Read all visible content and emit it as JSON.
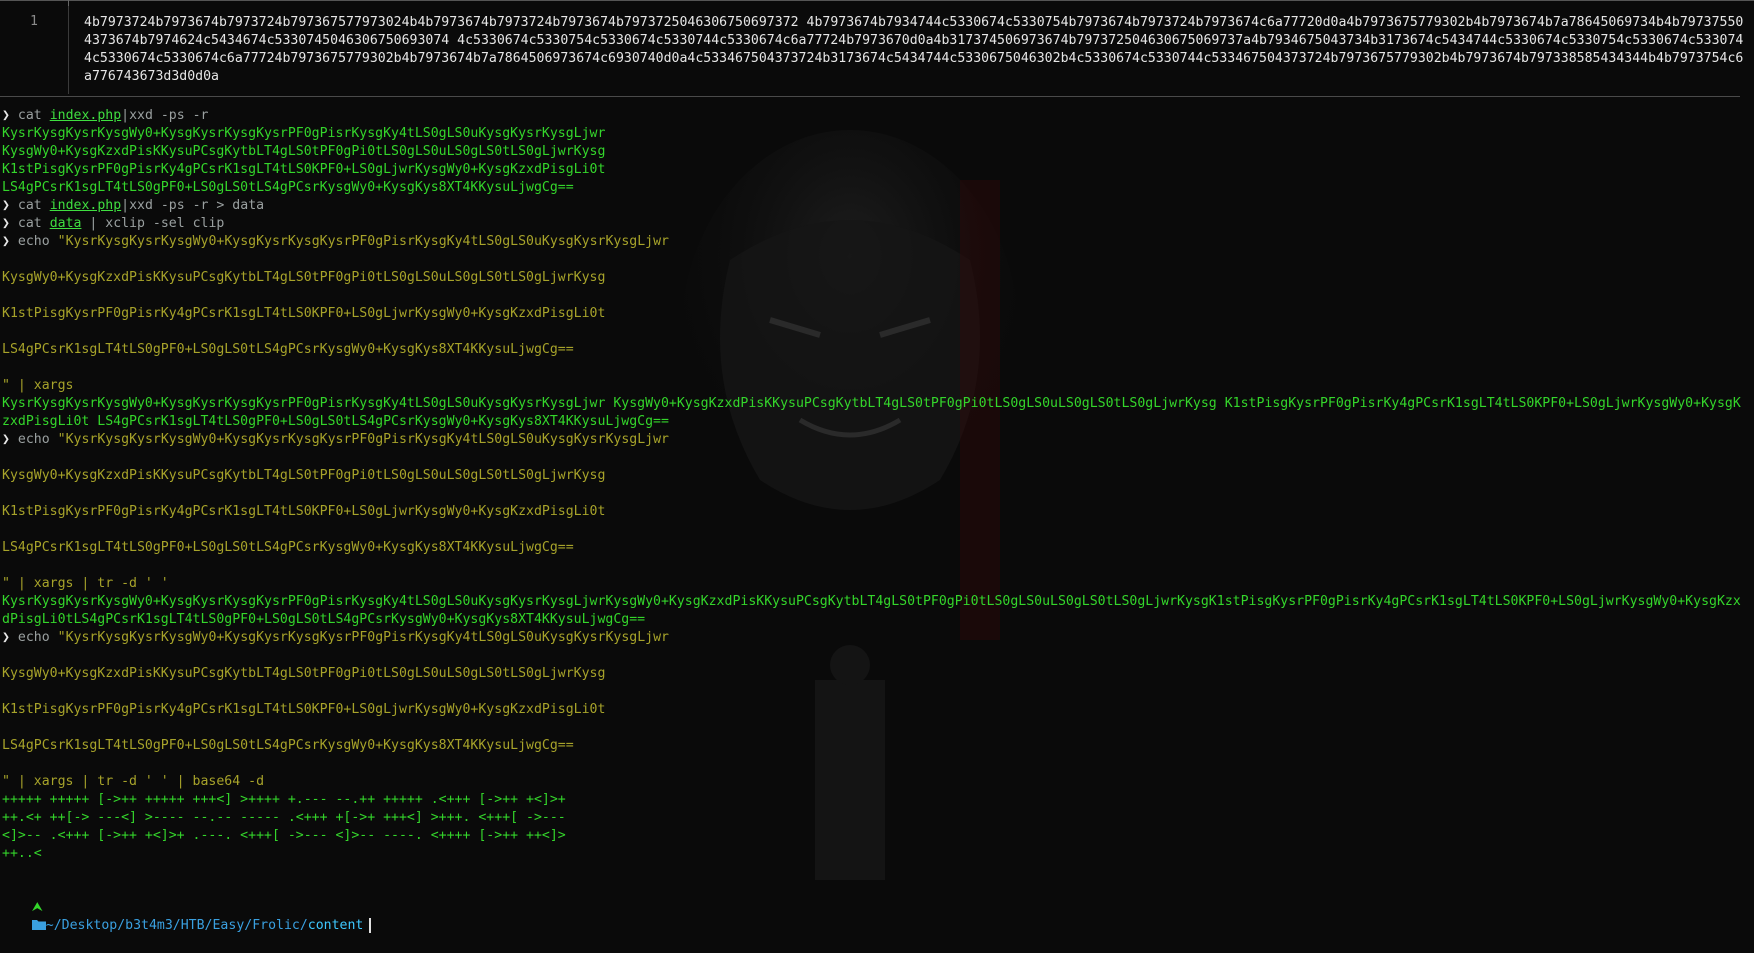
{
  "viewer": {
    "line_number": "1",
    "hex": "4b7973724b7973674b7973724b797367577973024b4b7973674b7973724b7973674b7973725046306750697372 4b7973674b7934744c5330674c5330754b7973674b7973724b7973674c6a77720d0a4b7973675779302b4b7973674b7a78645069734b4b797375504373674b7974624c5434674c5330745046306750693074 4c5330674c5330754c5330674c5330744c5330674c6a77724b7973670d0a4b317374506973674b797372504630675069737a4b7934675043734b3173674c5434744c5330674c5330754c5330674c5330744c5330674c5330674c6a77724b7973675779302b4b7973674b7a7864506973674c6930740d0a4c533467504373724b3173674c5434744c5330675046302b4c5330674c5330744c533467504373724b7973675779302b4b7973674b797338585434344b4b7973754c6a776743673d3d0d0a"
  },
  "terminal": {
    "prompt_char": "❯",
    "cmd1": {
      "cmd": "cat",
      "file": "index.php",
      "rest": "|xxd -ps -r"
    },
    "out1": [
      "KysrKysgKysrKysgWy0+KysgKysrKysgKysrPF0gPisrKysgKy4tLS0gLS0uKysgKysrKysgLjwr",
      "KysgWy0+KysgKzxdPisKKysuPCsgKytbLT4gLS0tPF0gPi0tLS0gLS0uLS0gLS0tLS0gLjwrKysg",
      "K1stPisgKysrPF0gPisrKy4gPCsrK1sgLT4tLS0KPF0+LS0gLjwrKysgWy0+KysgKzxdPisgLi0t",
      "LS4gPCsrK1sgLT4tLS0gPF0+LS0gLS0tLS4gPCsrKysgWy0+KysgKys8XT4KKysuLjwgCg=="
    ],
    "cmd2": {
      "cmd": "cat",
      "file": "index.php",
      "rest": "|xxd -ps -r > data"
    },
    "cmd3": {
      "cmd": "cat",
      "file": "data",
      "rest": " | xclip -sel clip"
    },
    "echo_cmd": "echo",
    "echo_lines": [
      "\"KysrKysgKysrKysgWy0+KysgKysrKysgKysrPF0gPisrKysgKy4tLS0gLS0uKysgKysrKysgLjwr",
      "KysgWy0+KysgKzxdPisKKysuPCsgKytbLT4gLS0tPF0gPi0tLS0gLS0uLS0gLS0tLS0gLjwrKysg",
      "K1stPisgKysrPF0gPisrKy4gPCsrK1sgLT4tLS0KPF0+LS0gLjwrKysgWy0+KysgKzxdPisgLi0t",
      "LS4gPCsrK1sgLT4tLS0gPF0+LS0gLS0tLS4gPCsrKysgWy0+KysgKys8XT4KKysuLjwgCg=="
    ],
    "tail1": "\" | xargs",
    "out2": "KysrKysgKysrKysgWy0+KysgKysrKysgKysrPF0gPisrKysgKy4tLS0gLS0uKysgKysrKysgLjwr KysgWy0+KysgKzxdPisKKysuPCsgKytbLT4gLS0tPF0gPi0tLS0gLS0uLS0gLS0tLS0gLjwrKysg K1stPisgKysrPF0gPisrKy4gPCsrK1sgLT4tLS0KPF0+LS0gLjwrKysgWy0+KysgKzxdPisgLi0t LS4gPCsrK1sgLT4tLS0gPF0+LS0gLS0tLS4gPCsrKysgWy0+KysgKys8XT4KKysuLjwgCg==",
    "tail2": "\" | xargs | tr -d ' '",
    "out3": "KysrKysgKysrKysgWy0+KysgKysrKysgKysrPF0gPisrKysgKy4tLS0gLS0uKysgKysrKysgLjwrKysgWy0+KysgKzxdPisKKysuPCsgKytbLT4gLS0tPF0gPi0tLS0gLS0uLS0gLS0tLS0gLjwrKysgK1stPisgKysrPF0gPisrKy4gPCsrK1sgLT4tLS0KPF0+LS0gLjwrKysgWy0+KysgKzxdPisgLi0tLS4gPCsrK1sgLT4tLS0gPF0+LS0gLS0tLS4gPCsrKysgWy0+KysgKys8XT4KKysuLjwgCg==",
    "tail3": "\" | xargs | tr -d ' ' | base64 -d",
    "out4": [
      "+++++ +++++ [->++ +++++ +++<] >++++ +.--- --.++ +++++ .<+++ [->++ +<]>+",
      "++.<+ ++[-> ---<] >---- --.-- ----- .<+++ +[->+ +++<] >+++. <+++[ ->---",
      "<]>-- .<+++ [->++ +<]>+ .---. <+++[ ->--- <]>-- ----. <++++ [->++ ++<]>",
      "++..<"
    ]
  },
  "status": {
    "arrow": "⮝",
    "folder_icon": "folder-icon",
    "path": "~/Desktop/b3t4m3/HTB/Easy/Frolic/",
    "leaf": "content"
  },
  "colors": {
    "green": "#34d62b",
    "olive": "#a7a32a",
    "blue": "#3aa0e0",
    "bg": "#0a0a0a"
  }
}
